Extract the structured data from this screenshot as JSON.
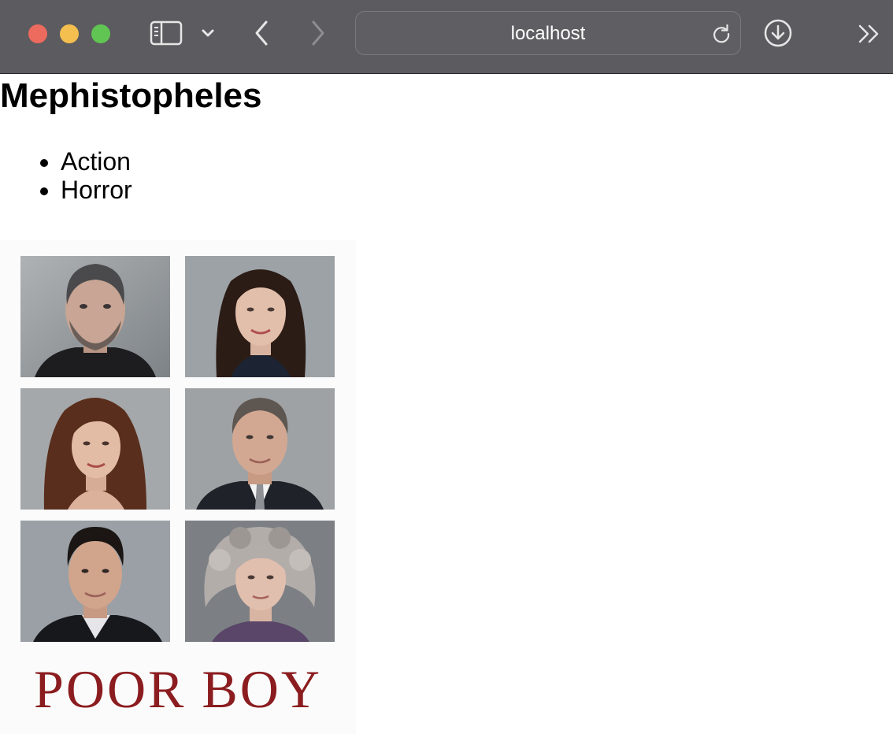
{
  "browser": {
    "address": "localhost",
    "colors": {
      "toolbar": "#5c5b5f",
      "close": "#ed6a5e",
      "minimize": "#f5bf4f",
      "zoom": "#61c554"
    },
    "icons": [
      "sidebar-icon",
      "chevron-down-icon",
      "back-icon",
      "forward-icon",
      "reload-icon",
      "download-icon",
      "more-icon"
    ]
  },
  "page": {
    "title": "Mephistopheles",
    "genres": [
      "Action",
      "Horror"
    ],
    "poster": {
      "title_text": "POOR BOY",
      "title_color": "#8b1c1f",
      "photos": [
        "portrait-man-grey-stubble",
        "portrait-woman-dark-hair",
        "portrait-woman-auburn-hair",
        "portrait-man-suit-tie",
        "portrait-man-dark-hair",
        "portrait-woman-grey-curls"
      ]
    }
  }
}
